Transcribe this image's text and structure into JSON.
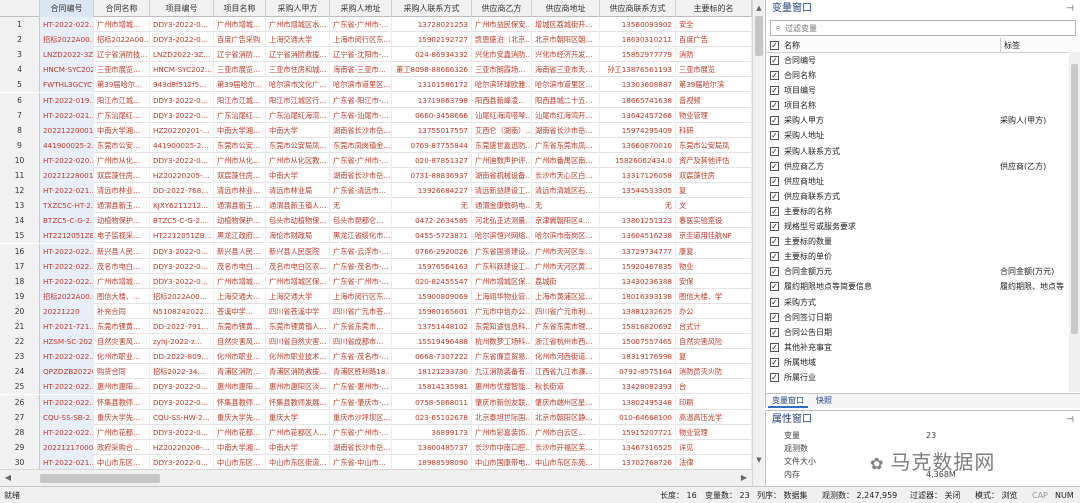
{
  "columns": [
    "合同编号",
    "合同名称",
    "项目编号",
    "项目名称",
    "采购人甲方",
    "采购人地址",
    "采购人联系方式",
    "供应商乙方",
    "供应商地址",
    "供应商联系方式",
    "主要标的名"
  ],
  "rows": [
    [
      "1",
      "HT-2022-022…",
      "广州市增城…",
      "DDY3-2022-0…",
      "广州市增城…",
      "广州市增城区水…",
      "广东省-广州市-…",
      "13728021253",
      "广州市益民保安…",
      "增城区荔城街开…",
      "13560093902",
      "安全"
    ],
    [
      "2",
      "招标2022A00…",
      "招标2022A00…",
      "DDY3-2022-0…",
      "百度广告采购",
      "上海交通大学",
      "上海市闵行区东…",
      "15902192727",
      "凯恩盛泊（北京…",
      "北京市朝阳区朝…",
      "18630310211",
      "百度广告"
    ],
    [
      "3",
      "LNZD2022-3Z…",
      "辽宁省消防技…",
      "LNZD2022-3Z…",
      "辽宁省消防…",
      "辽宁省消防救援…",
      "辽宁省-沈阳市-…",
      "024-86934332",
      "兴化市安鑫消防…",
      "兴化市经济开发…",
      "15852977779",
      "消防"
    ],
    [
      "4",
      "HNCM-SYC202…",
      "三亚市展览…",
      "HNCM-SYC202…",
      "三亚市展览…",
      "三亚市住房和城…",
      "海南省-三亚市…",
      "董工8098-88666326",
      "三亚市朗霞场…",
      "海南省三亚市天…",
      "孙工13876561193",
      "三亚市展览"
    ],
    [
      "5",
      "FWTHL3GCYC…",
      "第39届哈尔…",
      "943d8f512f5…",
      "第39届哈尔…",
      "哈尔滨市文化广…",
      "哈尔滨市道里区…",
      "13101586172",
      "哈尔滨环球欧雅…",
      "哈尔滨市道里区…",
      "13303608887",
      "第39届哈尔滨"
    ],
    [
      "6",
      "HT-2022-019…",
      "阳江市江城…",
      "DDY3-2022-0…",
      "阳江市江城…",
      "阳江市江城区行…",
      "广东省-阳江市-…",
      "13719863798",
      "阳西县新峰凌…",
      "阳西县城二十五…",
      "18665741638",
      "音视频"
    ],
    [
      "7",
      "HT-2022-021…",
      "广东汕尾红…",
      "DDY3-2022-0…",
      "广东汕尾红…",
      "广东汕尾红海湾…",
      "广东省-汕尾市-…",
      "0660-3458666",
      "汕尾红海湾嗒琴…",
      "汕尾市红海湾开…",
      "13642457266",
      "物业管理"
    ],
    [
      "8",
      "20221220001…",
      "中南大学湘…",
      "HZ20220201-…",
      "中南大学湘…",
      "中南大学",
      "湖南省长沙市岳…",
      "13755017557",
      "艾西仑（湖南）…",
      "湖南省长沙市岳…",
      "15974295409",
      "科研"
    ],
    [
      "9",
      "441900025-2…",
      "东莞市公安…",
      "441900025-2…",
      "东莞市公安…",
      "东莞市公安局凤…",
      "东莞市凤岗镇金…",
      "0769-87755844",
      "东莞盛世嘉迅防…",
      "广东省东莞市凤…",
      "13660870010",
      "东莞市公安局凤"
    ],
    [
      "10",
      "HT-2022-020…",
      "广州市从化…",
      "DDY3-2022-0…",
      "广州市从化…",
      "广州市从化区教…",
      "广东省-广州市-…",
      "020-87851327",
      "广州迪数声护评…",
      "广州市番禺区南…",
      "15826062434.0",
      "资产及其他评估"
    ],
    [
      "11",
      "20221228001…",
      "双宸藻住房…",
      "HZ20220205-…",
      "双宸藻住房…",
      "中南大学",
      "湖南省长沙市岳…",
      "0731-88836937",
      "湖南省机械设备…",
      "长沙市天心区白…",
      "13317126058",
      "双宸藻住房"
    ],
    [
      "12",
      "HT-2022-021…",
      "清远市林业…",
      "DD-2022-768…",
      "清远市林业…",
      "清远市林业局",
      "广东省-清远市…",
      "13926684227",
      "清远新益建设工…",
      "清远市清城区石…",
      "13544533305",
      "复"
    ],
    [
      "13",
      "TXZC5C-HT-2…",
      "通渭县新玉…",
      "KJXY6211212…",
      "通渭县新玉…",
      "通渭县新玉镇人…",
      "无",
      "无",
      "通渭金康数码电…",
      "无",
      "无",
      "文"
    ],
    [
      "14",
      "BTZC5-C-G-2…",
      "动植物保护…",
      "BTZC5-C-G-2…",
      "动植物保护…",
      "包头市动植物保…",
      "包头市昆都仑…",
      "0472-2634585",
      "河北弘正达测量…",
      "京津冀朝阳区4…",
      "13801251323",
      "春医实验室设"
    ],
    [
      "15",
      "HT2212051ZB…",
      "电子监视采…",
      "HT2212051ZB…",
      "黑龙江政府…",
      "海伦市财政局",
      "黑龙江省绥化市…",
      "0455-5723871",
      "哈尔滨恒兴网络…",
      "哈尔滨市南岗区…",
      "13604516238",
      "京圭道用佳航NF"
    ],
    [
      "16",
      "HT-2022-022…",
      "新兴县人民…",
      "DDY3-2022-0…",
      "新兴县人民…",
      "新兴县人民医院",
      "广东省-云浮市-…",
      "0766-2920026",
      "广东省国资建设…",
      "广州市天河区车…",
      "13729734777",
      "康复"
    ],
    [
      "17",
      "HT-2022-022…",
      "茂名市电白…",
      "DDY3-2022-0…",
      "茂名市电白…",
      "茂名市电白区农…",
      "广东省-茂名市-…",
      "15976564163",
      "广东科跃建设工…",
      "广州市天河区黄…",
      "15920467835",
      "物业"
    ],
    [
      "18",
      "HT-2022-022…",
      "广州市增城…",
      "DDY3-2022-0…",
      "广州市增城…",
      "广州市增城区保…",
      "广东省-广州市-…",
      "020-82455547",
      "广州市增城区保…",
      "荔城街",
      "13430236388",
      "安保"
    ],
    [
      "19",
      "招标2022A00…",
      "图信大楼、…",
      "招标2022A00…",
      "上海交通大…",
      "上海交通大学",
      "上海市闵行区东…",
      "15900809069",
      "上海翊华物业管…",
      "上海市黄浦区延…",
      "18016393138",
      "图信大楼、学"
    ],
    [
      "20",
      "20221220",
      "补充合同",
      "N5108242022…",
      "苍溪中学…",
      "四川省苍溪中学",
      "四川省广元市苍…",
      "15980165601",
      "广元市中信办公…",
      "四川省广元市利…",
      "13881232625",
      "办公"
    ],
    [
      "21",
      "HT-2021-721…",
      "东莞市锂黄…",
      "DD-2022-791…",
      "东莞市锂黄…",
      "东莞市锂黄镇人…",
      "广东省东莞市…",
      "13751448102",
      "东莞知途信息科…",
      "广东省东莞市锂…",
      "15816820692",
      "台式计"
    ],
    [
      "22",
      "HZSM-SC-202…",
      "自然灾害风…",
      "zyhj-2022-z…",
      "自然灾害风…",
      "四川省自然灾害…",
      "四川省成都市…",
      "15519496488",
      "杭州数梦工场科…",
      "浙江省杭州市西…",
      "15007557465",
      "自然灾害风险"
    ],
    [
      "23",
      "HT-2022-022…",
      "化州市职业…",
      "DD-2022-809…",
      "化州市职业…",
      "化州市职业技术…",
      "广东省-茂名市-…",
      "0668-7307222",
      "广东省廉宣贸易…",
      "化州市河西街道…",
      "18319176998",
      "复"
    ],
    [
      "24",
      "QPZDZB20220…",
      "购货合同",
      "招标2022-34…",
      "青浦区消防…",
      "青浦区消防救援…",
      "青浦区胜利路18…",
      "18121233730",
      "九江消防装备有…",
      "江西省九江市濂…",
      "0792-8575164",
      "消防员灭火防"
    ],
    [
      "25",
      "HT-2022-022…",
      "惠州市惠阳…",
      "DDY3-2022-0…",
      "惠州市惠阳…",
      "惠州市惠阳区淡…",
      "广东省-惠州市-…",
      "15814135981",
      "惠州市优搜智能…",
      "秋长街道",
      "13428082393",
      "台"
    ],
    [
      "26",
      "HT-2022-022…",
      "怀集县教师…",
      "DDY3-2022-0…",
      "怀集县教师…",
      "怀集县教师发展…",
      "广东省-肇庆市-…",
      "0758-5868011",
      "肇庆市新创友联…",
      "肇庆市端州区星…",
      "13802495348",
      "印刷"
    ],
    [
      "27",
      "CQU-SS-SB-2…",
      "重庆大学先…",
      "CQU-SS-HW-2…",
      "重庆大学先…",
      "重庆大学",
      "重庆市沙坪坝区…",
      "023-65102678",
      "北京泰坦世际国…",
      "北京市朝阳区静…",
      "010-64668100",
      "高温高压光学"
    ],
    [
      "28",
      "HT-2022-022…",
      "广州市花都…",
      "DDY3-2022-0…",
      "广州市花都…",
      "广州市花都区人…",
      "广东省-广州市-…",
      "36899173",
      "广州市彩嘉装饰…",
      "广州市白云区…",
      "15915207721",
      "物业管理"
    ],
    [
      "29",
      "20221217000…",
      "政府采购合…",
      "HZ20220206-…",
      "中南大学湘…",
      "中南大学",
      "湖南省长沙市岳…",
      "13800485737",
      "长沙市中南口腔…",
      "长沙市开福区芙…",
      "13467316525",
      "详见"
    ],
    [
      "30",
      "HT-2022-021…",
      "中山市东区…",
      "DDY3-2022-0…",
      "中山市东区…",
      "中山市东区街道…",
      "广东省-中山市…",
      "18988598090",
      "中山市国康带电…",
      "中山市东区东苑…",
      "13702768726",
      "法律"
    ],
    [
      "31",
      "HT-2022-022…",
      "广州市番禺…",
      "DDY3-2022-0…",
      "广州市番禺…",
      "广州市番禺区人…",
      "广东省-广州市-…",
      "13553220389",
      "广州市保德房地…",
      "广州市黄埔区沃…",
      "13660574718",
      "安全"
    ],
    [
      "32",
      "HT-2022-022…",
      "韩山市沙埔…",
      "DD-2022-749…",
      "韩山市沙埔…",
      "韩山市沙埔街道…",
      "广东省江门市韩…",
      "8885004",
      "韩山市嘉彩办公…",
      "韩山市沙埔东乐…",
      "15875005977",
      "触控一"
    ]
  ],
  "variables_pane": {
    "title": "变量窗口",
    "pin": "⊣",
    "filter_placeholder": "过滤变量",
    "col_name": "名称",
    "col_label": "标签",
    "items": [
      {
        "name": "合同编号",
        "label": ""
      },
      {
        "name": "合同名称",
        "label": ""
      },
      {
        "name": "项目编号",
        "label": ""
      },
      {
        "name": "项目名称",
        "label": ""
      },
      {
        "name": "采购人甲方",
        "label": "采购人(甲方)"
      },
      {
        "name": "采购人地址",
        "label": ""
      },
      {
        "name": "采购人联系方式",
        "label": ""
      },
      {
        "name": "供应商乙方",
        "label": "供应商(乙方)"
      },
      {
        "name": "供应商地址",
        "label": ""
      },
      {
        "name": "供应商联系方式",
        "label": ""
      },
      {
        "name": "主要标的名称",
        "label": ""
      },
      {
        "name": "规格型号或服务要求",
        "label": ""
      },
      {
        "name": "主要标的数量",
        "label": ""
      },
      {
        "name": "主要标的单价",
        "label": ""
      },
      {
        "name": "合同金额万元",
        "label": "合同金额(万元)"
      },
      {
        "name": "履约期限地点等简要信息",
        "label": "履约期限、地点等"
      },
      {
        "name": "采购方式",
        "label": ""
      },
      {
        "name": "合同签订日期",
        "label": ""
      },
      {
        "name": "合同公告日期",
        "label": ""
      },
      {
        "name": "其他补充事宜",
        "label": ""
      },
      {
        "name": "所属地域",
        "label": ""
      },
      {
        "name": "所属行业",
        "label": ""
      }
    ],
    "tabs": [
      "变量窗口",
      "快照"
    ]
  },
  "properties_pane": {
    "title": "属性窗口",
    "pin": "⊣",
    "rows": [
      {
        "key": "变量",
        "value": "23"
      },
      {
        "key": "观测数",
        "value": ""
      },
      {
        "key": "文件大小",
        "value": ""
      },
      {
        "key": "内存",
        "value": "4,368M"
      }
    ]
  },
  "watermark": "马克数据网",
  "status": {
    "left": "就绪",
    "length": "长度： 16",
    "vars": "变量数： 23",
    "order": "列序： 数据集",
    "obs": "观测数： 2,247,959",
    "filter": "过滤器： 关闭",
    "mode": "模式： 浏览",
    "cap": "CAP",
    "num": "NUM"
  }
}
